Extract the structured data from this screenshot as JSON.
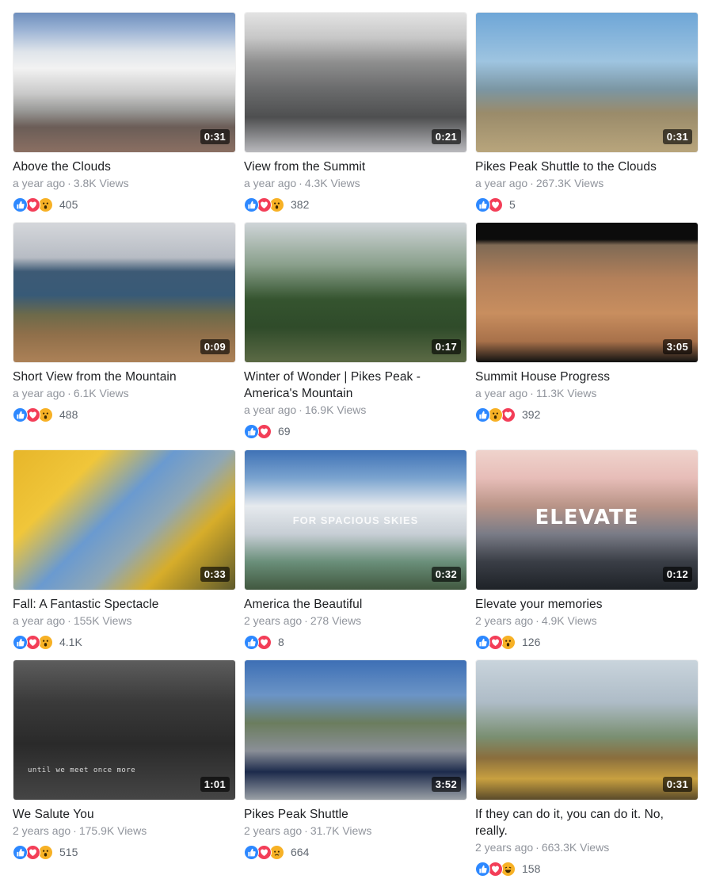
{
  "videos": [
    {
      "title": "Above the Clouds",
      "age": "a year ago",
      "views": "3.8K Views",
      "duration": "0:31",
      "reactions": [
        "like",
        "love",
        "wow"
      ],
      "reaction_count": "405"
    },
    {
      "title": "View from the Summit",
      "age": "a year ago",
      "views": "4.3K Views",
      "duration": "0:21",
      "reactions": [
        "like",
        "love",
        "wow"
      ],
      "reaction_count": "382"
    },
    {
      "title": "Pikes Peak Shuttle to the Clouds",
      "age": "a year ago",
      "views": "267.3K Views",
      "duration": "0:31",
      "reactions": [
        "like",
        "love"
      ],
      "reaction_count": "5"
    },
    {
      "title": "Short View from the Mountain",
      "age": "a year ago",
      "views": "6.1K Views",
      "duration": "0:09",
      "reactions": [
        "like",
        "love",
        "wow"
      ],
      "reaction_count": "488"
    },
    {
      "title": "Winter of Wonder | Pikes Peak - America's Mountain",
      "age": "a year ago",
      "views": "16.9K Views",
      "duration": "0:17",
      "reactions": [
        "like",
        "love"
      ],
      "reaction_count": "69"
    },
    {
      "title": "Summit House Progress",
      "age": "a year ago",
      "views": "11.3K Views",
      "duration": "3:05",
      "reactions": [
        "like",
        "wow",
        "love"
      ],
      "reaction_count": "392"
    },
    {
      "title": "Fall: A Fantastic Spectacle",
      "age": "a year ago",
      "views": "155K Views",
      "duration": "0:33",
      "reactions": [
        "like",
        "love",
        "wow"
      ],
      "reaction_count": "4.1K"
    },
    {
      "title": "America the Beautiful",
      "age": "2 years ago",
      "views": "278 Views",
      "duration": "0:32",
      "reactions": [
        "like",
        "love"
      ],
      "reaction_count": "8",
      "overlay": "FOR SPACIOUS SKIES"
    },
    {
      "title": "Elevate your memories",
      "age": "2 years ago",
      "views": "4.9K Views",
      "duration": "0:12",
      "reactions": [
        "like",
        "love",
        "wow"
      ],
      "reaction_count": "126",
      "overlay": "ELEVATE"
    },
    {
      "title": "We Salute You",
      "age": "2 years ago",
      "views": "175.9K Views",
      "duration": "1:01",
      "reactions": [
        "like",
        "love",
        "wow"
      ],
      "reaction_count": "515",
      "overlay": "until we meet once more"
    },
    {
      "title": "Pikes Peak Shuttle",
      "age": "2 years ago",
      "views": "31.7K Views",
      "duration": "3:52",
      "reactions": [
        "like",
        "love",
        "sad"
      ],
      "reaction_count": "664"
    },
    {
      "title": "If they can do it, you can do it. No, really.",
      "age": "2 years ago",
      "views": "663.3K Views",
      "duration": "0:31",
      "reactions": [
        "like",
        "love",
        "haha"
      ],
      "reaction_count": "158"
    }
  ],
  "separator": "·",
  "colors": {
    "like": "#2d88ff",
    "love": "#f33e58",
    "wow": "#f7b125",
    "title": "#1c1e21",
    "meta": "#90949c"
  }
}
